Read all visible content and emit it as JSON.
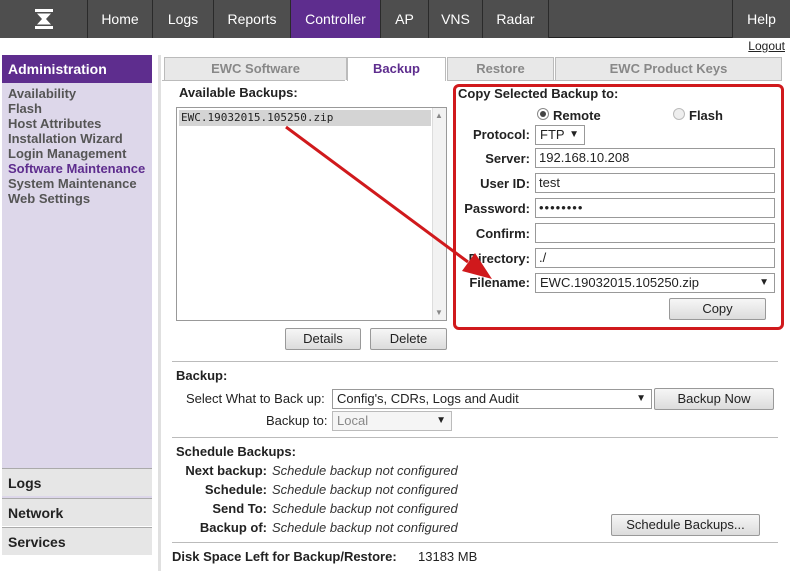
{
  "topnav": {
    "tabs": [
      {
        "label": "Home"
      },
      {
        "label": "Logs"
      },
      {
        "label": "Reports"
      },
      {
        "label": "Controller"
      },
      {
        "label": "AP"
      },
      {
        "label": "VNS"
      },
      {
        "label": "Radar"
      },
      {
        "label": "Help"
      }
    ],
    "logout": "Logout",
    "active_color": "#5e2d8e"
  },
  "sidebar": {
    "header": "Administration",
    "items": [
      {
        "label": "Availability"
      },
      {
        "label": "Flash"
      },
      {
        "label": "Host Attributes"
      },
      {
        "label": "Installation Wizard"
      },
      {
        "label": "Login Management"
      },
      {
        "label": "Software Maintenance"
      },
      {
        "label": "System Maintenance"
      },
      {
        "label": "Web Settings"
      }
    ],
    "sections": [
      {
        "label": "Logs"
      },
      {
        "label": "Network"
      },
      {
        "label": "Services"
      }
    ]
  },
  "subtabs": [
    {
      "label": "EWC Software"
    },
    {
      "label": "Backup"
    },
    {
      "label": "Restore"
    },
    {
      "label": "EWC Product Keys"
    }
  ],
  "backups": {
    "title": "Available Backups:",
    "items": [
      "EWC.19032015.105250.zip"
    ],
    "details_button": "Details",
    "delete_button": "Delete"
  },
  "copy": {
    "title": "Copy Selected Backup to:",
    "radio_remote": "Remote",
    "radio_flash": "Flash",
    "protocol_label": "Protocol:",
    "protocol_value": "FTP",
    "server_label": "Server:",
    "server_value": "192.168.10.208",
    "userid_label": "User ID:",
    "userid_value": "test",
    "password_label": "Password:",
    "password_value": "••••••••",
    "confirm_label": "Confirm:",
    "confirm_value": "",
    "directory_label": "Directory:",
    "directory_value": "./",
    "filename_label": "Filename:",
    "filename_value": "EWC.19032015.105250.zip",
    "copy_button": "Copy"
  },
  "backup": {
    "title": "Backup:",
    "what_label": "Select What to Back up:",
    "what_value": "Config's, CDRs, Logs and Audit",
    "backup_now_button": "Backup Now",
    "to_label": "Backup to:",
    "to_value": "Local"
  },
  "schedule": {
    "title": "Schedule Backups:",
    "rows": [
      {
        "label": "Next backup:",
        "value": "Schedule backup not configured"
      },
      {
        "label": "Schedule:",
        "value": "Schedule backup not configured"
      },
      {
        "label": "Send To:",
        "value": "Schedule backup not configured"
      },
      {
        "label": "Backup of:",
        "value": "Schedule backup not configured"
      }
    ],
    "button": "Schedule Backups..."
  },
  "disk": {
    "label": "Disk Space Left for Backup/Restore:",
    "value": "13183 MB"
  },
  "annotation_color": "#d0191c"
}
